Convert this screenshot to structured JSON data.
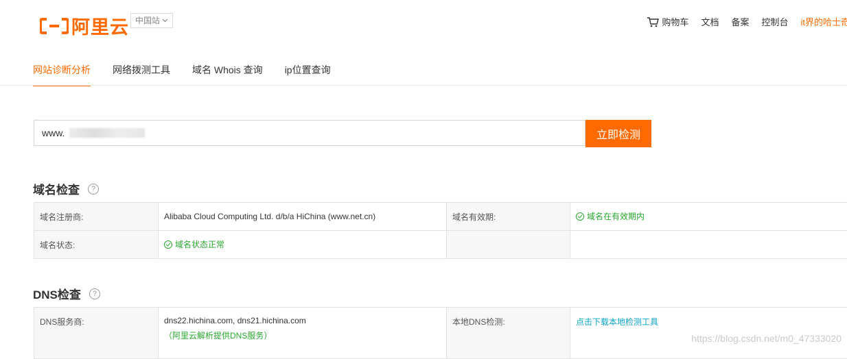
{
  "header": {
    "logo_text": "阿里云",
    "site_select": "中国站",
    "nav": [
      {
        "label": "购物车",
        "icon": "cart-icon"
      },
      {
        "label": "文档"
      },
      {
        "label": "备案"
      },
      {
        "label": "控制台"
      },
      {
        "label": "it界的哈士奇"
      }
    ]
  },
  "tabs": [
    "网站诊断分析",
    "网络拨测工具",
    "域名 Whois 查询",
    "ip位置查询"
  ],
  "search": {
    "value": "www.",
    "button": "立即检测"
  },
  "domain_check": {
    "title": "域名检查",
    "rows": [
      {
        "label1": "域名注册商:",
        "value1": "Alibaba Cloud Computing Ltd. d/b/a HiChina (www.net.cn)",
        "label2": "域名有效期:",
        "value2": "域名在有效期内"
      },
      {
        "label1": "域名状态:",
        "value1": "域名状态正常",
        "label2": "",
        "value2": ""
      }
    ]
  },
  "dns_check": {
    "title": "DNS检查",
    "provider_label": "DNS服务商:",
    "provider_value": "dns22.hichina.com, dns21.hichina.com",
    "provider_note": "（阿里云解析提供DNS服务）",
    "local_label": "本地DNS检测:",
    "local_link": "点击下载本地检测工具"
  },
  "watermark": "https://blog.csdn.net/m0_47333020",
  "colors": {
    "accent": "#ff6a00",
    "ok": "#2aa830",
    "link": "#0aa3c9"
  }
}
